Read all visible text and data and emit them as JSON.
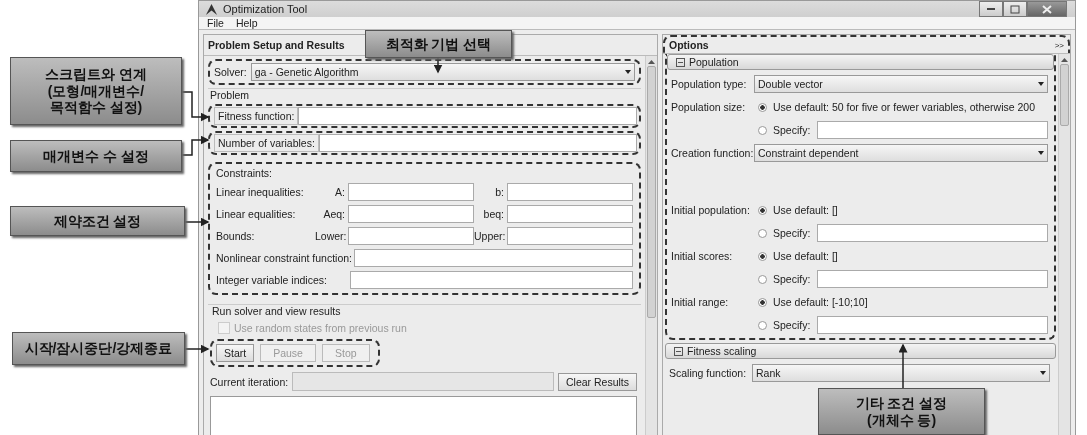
{
  "window": {
    "title": "Optimization Tool"
  },
  "menu": [
    "File",
    "Help"
  ],
  "problem_panel": {
    "title": "Problem Setup and Results",
    "solver": {
      "label": "Solver:",
      "value": "ga - Genetic Algorithm"
    },
    "problem": {
      "title": "Problem",
      "fields": [
        {
          "label": "Fitness function:"
        },
        {
          "label": "Number of variables:"
        }
      ]
    },
    "constraints": {
      "title": "Constraints:",
      "rows": [
        {
          "kind": "pair",
          "label": "Linear inequalities:",
          "fields": [
            {
              "label": "A:"
            },
            {
              "label": "b:"
            }
          ]
        },
        {
          "kind": "pair",
          "label": "Linear equalities:",
          "fields": [
            {
              "label": "Aeq:"
            },
            {
              "label": "beq:"
            }
          ]
        },
        {
          "kind": "pair",
          "label": "Bounds:",
          "fields": [
            {
              "label": "Lower:"
            },
            {
              "label": "Upper:"
            }
          ]
        },
        {
          "kind": "single",
          "label": "Nonlinear constraint function:"
        },
        {
          "kind": "single",
          "label": "Integer variable indices:"
        }
      ]
    },
    "run": {
      "title": "Run solver and view results",
      "checkbox": {
        "label": "Use random states from previous run",
        "checked": false,
        "disabled": true
      },
      "buttons": [
        {
          "label": "Start",
          "disabled": false
        },
        {
          "label": "Pause",
          "disabled": true
        },
        {
          "label": "Stop",
          "disabled": true
        }
      ],
      "iteration_label": "Current iteration:",
      "clear_button": "Clear Results"
    }
  },
  "options_panel": {
    "title": "Options",
    "expand_button": ">>",
    "sections": [
      {
        "title": "Population",
        "expanded": true,
        "rows": [
          {
            "kind": "dropdown",
            "label": "Population type:",
            "value": "Double vector"
          },
          {
            "kind": "radio",
            "label": "Population size:",
            "options": [
              {
                "kind": "default",
                "label": "Use default: 50 for five or fewer variables, otherwise 200",
                "selected": true
              },
              {
                "kind": "specify",
                "label": "Specify:",
                "selected": false
              }
            ]
          },
          {
            "kind": "dropdown",
            "label": "Creation function:",
            "value": "Constraint dependent"
          },
          {
            "kind": "radio",
            "label": "Initial population:",
            "options": [
              {
                "kind": "default",
                "label": "Use default: []",
                "selected": true
              },
              {
                "kind": "specify",
                "label": "Specify:",
                "selected": false
              }
            ]
          },
          {
            "kind": "radio",
            "label": "Initial scores:",
            "options": [
              {
                "kind": "default",
                "label": "Use default: []",
                "selected": true
              },
              {
                "kind": "specify",
                "label": "Specify:",
                "selected": false
              }
            ]
          },
          {
            "kind": "radio",
            "label": "Initial range:",
            "options": [
              {
                "kind": "default",
                "label": "Use default: [-10;10]",
                "selected": true
              },
              {
                "kind": "specify",
                "label": "Specify:",
                "selected": false
              }
            ]
          }
        ]
      },
      {
        "title": "Fitness scaling",
        "expanded": true,
        "rows": [
          {
            "kind": "dropdown",
            "label": "Scaling function:",
            "value": "Rank"
          }
        ]
      }
    ]
  },
  "callouts": [
    {
      "lines": [
        "스크립트와 연계",
        "(모형/매개변수/",
        "목적함수 설정)"
      ]
    },
    {
      "lines": [
        "매개변수 수 설정"
      ]
    },
    {
      "lines": [
        "제약조건 설정"
      ]
    },
    {
      "lines": [
        "시작/잠시중단/강제종료"
      ]
    },
    {
      "lines": [
        "최적화 기법 선택"
      ]
    },
    {
      "lines": [
        "기타 조건 설정",
        "(개체수 등)"
      ]
    }
  ]
}
